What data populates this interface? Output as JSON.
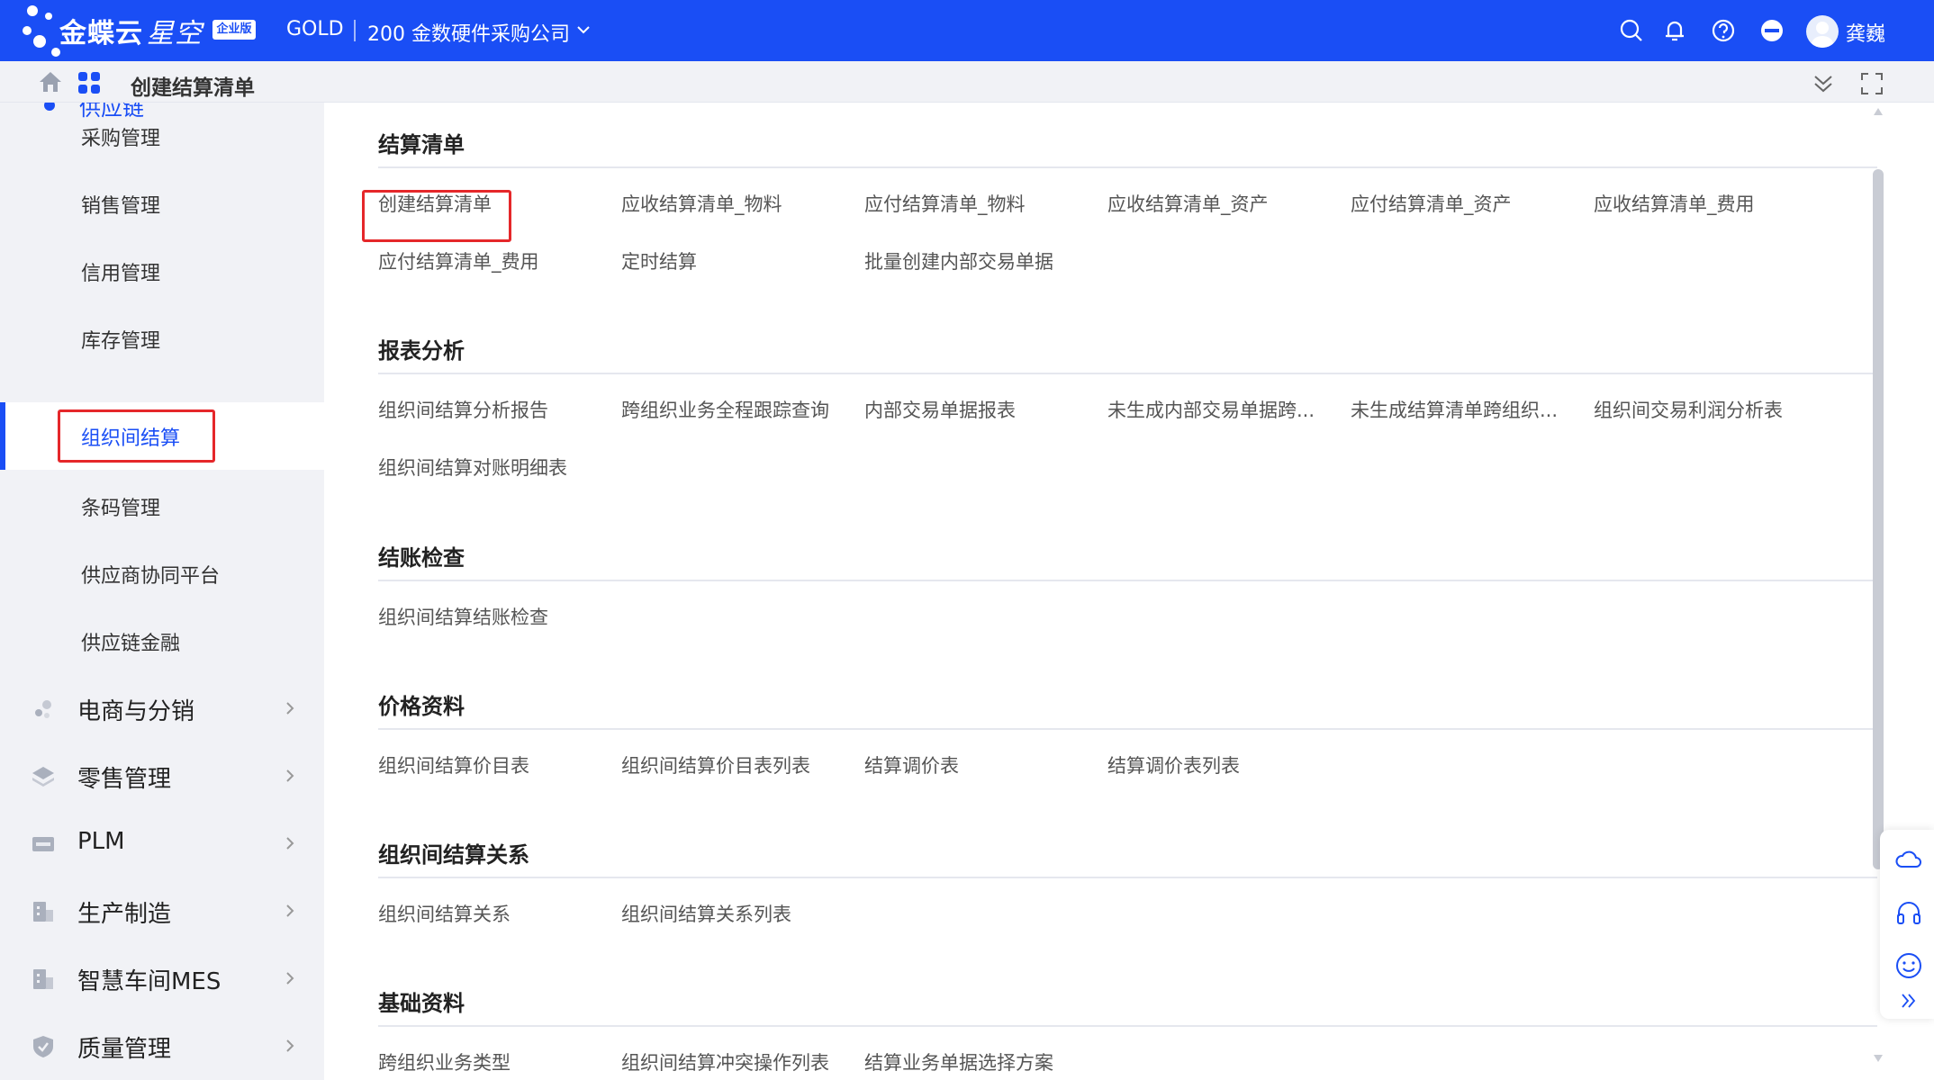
{
  "header": {
    "brand": "金蝶云",
    "brand_suffix": "星空",
    "edition": "企业版",
    "tenant": "GOLD",
    "company": "200 金数硬件采购公司",
    "username": "龚巍",
    "accent": "#1a4ef5"
  },
  "breadcrumb": {
    "title": "创建结算清单"
  },
  "sidebar": {
    "parent": "供应链",
    "sub_items": [
      {
        "label": "采购管理"
      },
      {
        "label": "销售管理"
      },
      {
        "label": "信用管理"
      },
      {
        "label": "库存管理"
      },
      {
        "label": "组织间结算",
        "active": true
      },
      {
        "label": "条码管理"
      },
      {
        "label": "供应商协同平台"
      },
      {
        "label": "供应链金融"
      }
    ],
    "modules": [
      {
        "label": "电商与分销",
        "icon": "ecommerce-icon"
      },
      {
        "label": "零售管理",
        "icon": "layers-icon"
      },
      {
        "label": "PLM",
        "icon": "plm-icon"
      },
      {
        "label": "生产制造",
        "icon": "factory-icon"
      },
      {
        "label": "智慧车间MES",
        "icon": "workshop-icon"
      },
      {
        "label": "质量管理",
        "icon": "shield-icon"
      }
    ]
  },
  "sections": [
    {
      "title": "结算清单",
      "items": [
        "创建结算清单",
        "应收结算清单_物料",
        "应付结算清单_物料",
        "应收结算清单_资产",
        "应付结算清单_资产",
        "应收结算清单_费用",
        "应付结算清单_费用",
        "定时结算",
        "批量创建内部交易单据"
      ]
    },
    {
      "title": "报表分析",
      "items": [
        "组织间结算分析报告",
        "跨组织业务全程跟踪查询",
        "内部交易单据报表",
        "未生成内部交易单据跨...",
        "未生成结算清单跨组织...",
        "组织间交易利润分析表",
        "组织间结算对账明细表"
      ]
    },
    {
      "title": "结账检查",
      "items": [
        "组织间结算结账检查"
      ]
    },
    {
      "title": "价格资料",
      "items": [
        "组织间结算价目表",
        "组织间结算价目表列表",
        "结算调价表",
        "结算调价表列表"
      ]
    },
    {
      "title": "组织间结算关系",
      "items": [
        "组织间结算关系",
        "组织间结算关系列表"
      ]
    },
    {
      "title": "基础资料",
      "items": [
        "跨组织业务类型",
        "组织间结算冲突操作列表",
        "结算业务单据选择方案"
      ]
    }
  ]
}
